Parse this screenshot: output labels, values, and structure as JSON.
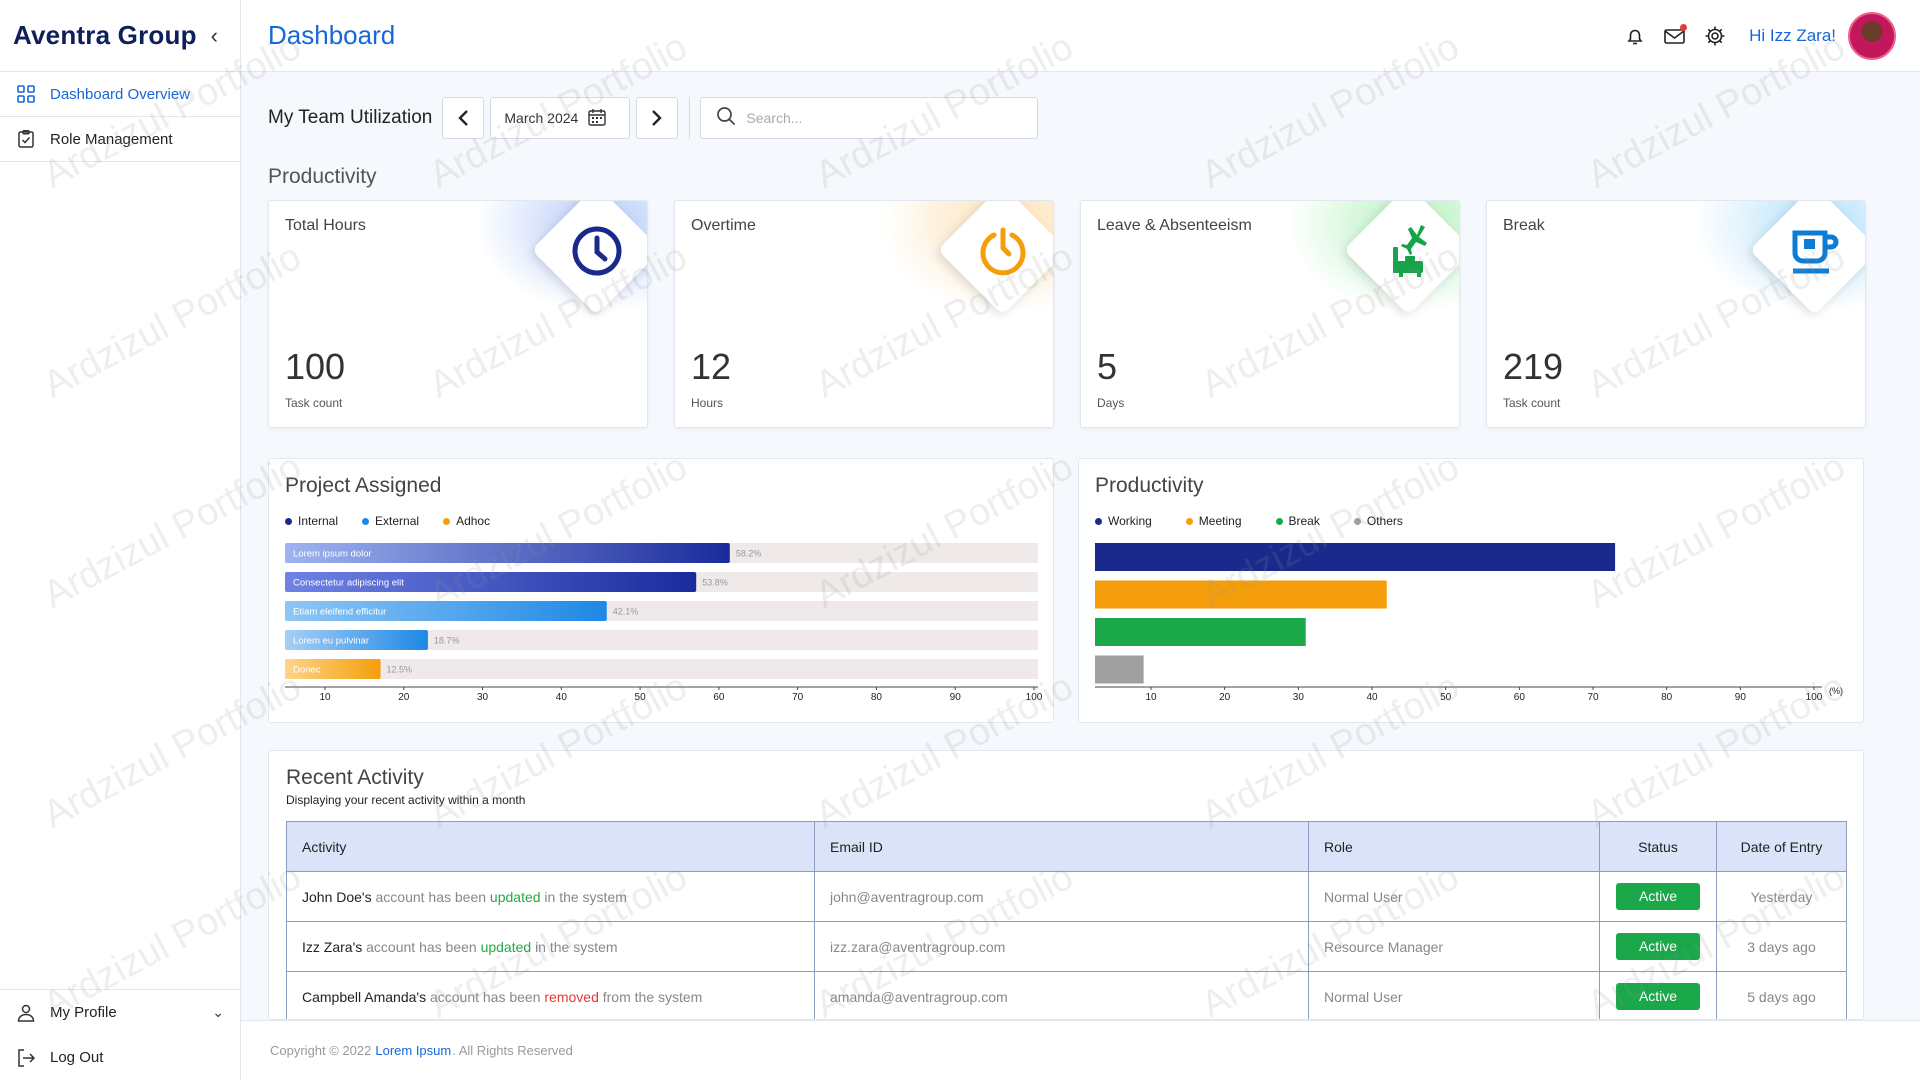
{
  "sidebar": {
    "brand": "Aventra Group",
    "items": [
      {
        "label": "Dashboard Overview"
      },
      {
        "label": "Role Management"
      }
    ],
    "bottom": [
      {
        "label": "My Profile"
      },
      {
        "label": "Log Out"
      }
    ]
  },
  "header": {
    "title": "Dashboard",
    "greeting": "Hi Izz Zara!"
  },
  "toolbar": {
    "title": "My Team Utilization",
    "month": "March 2024",
    "search_placeholder": "Search..."
  },
  "productivity_section": "Productivity",
  "cards": [
    {
      "label": "Total Hours",
      "value": "100",
      "unit": "Task count",
      "icon": "clock-icon",
      "color": "#1a2a8c"
    },
    {
      "label": "Overtime",
      "value": "12",
      "unit": "Hours",
      "icon": "power-timer-icon",
      "color": "#f59e0b"
    },
    {
      "label": "Leave & Absenteeism",
      "value": "5",
      "unit": "Days",
      "icon": "plane-luggage-icon",
      "color": "#16a34a"
    },
    {
      "label": "Break",
      "value": "219",
      "unit": "Task count",
      "icon": "coffee-cup-icon",
      "color": "#0c7cd5"
    }
  ],
  "project_panel": {
    "title": "Project Assigned"
  },
  "productivity_panel": {
    "title": "Productivity"
  },
  "chart_data": [
    {
      "type": "bar",
      "orientation": "horizontal",
      "title": "Project Assigned",
      "legend": [
        "Internal",
        "External",
        "Adhoc"
      ],
      "legend_colors": [
        "#1a2a8c",
        "#1e88e5",
        "#f59e0b"
      ],
      "categories": [
        "Lorem ipsum dolor",
        "Consectetur adipiscing elit",
        "Etiam eleifend efficitur",
        "Lorem eu pulvinar",
        "Donec"
      ],
      "values": [
        58.2,
        53.8,
        42.1,
        18.7,
        12.5
      ],
      "value_labels": [
        "58.2%",
        "53.8%",
        "42.1%",
        "18.7%",
        "12.5%"
      ],
      "xticks": [
        "10",
        "20",
        "30",
        "40",
        "50",
        "60",
        "70",
        "80",
        "90",
        "100"
      ],
      "xlim": [
        3,
        100
      ]
    },
    {
      "type": "bar",
      "orientation": "horizontal",
      "title": "Productivity",
      "legend": [
        "Working",
        "Meeting",
        "Break",
        "Others"
      ],
      "legend_colors": [
        "#1a2a8c",
        "#f59e0b",
        "#1aa84a",
        "#a0a0a0"
      ],
      "values": [
        73,
        42,
        31,
        9
      ],
      "xticks": [
        "10",
        "20",
        "30",
        "40",
        "50",
        "60",
        "70",
        "80",
        "90",
        "100"
      ],
      "xunit": "(%)",
      "xlim": [
        2,
        100
      ]
    }
  ],
  "activity": {
    "title": "Recent Activity",
    "subtitle": "Displaying your recent activity within a month",
    "headers": [
      "Activity",
      "Email ID",
      "Role",
      "Status",
      "Date of Entry"
    ],
    "rows": [
      {
        "name": "John Doe's",
        "pre": "account has been",
        "action": "updated",
        "action_type": "green",
        "post": "in the system",
        "email": "john@aventragroup.com",
        "role": "Normal User",
        "status": "Active",
        "date": "Yesterday"
      },
      {
        "name": "Izz Zara's",
        "pre": "account has been",
        "action": "updated",
        "action_type": "green",
        "post": "in the system",
        "email": "izz.zara@aventragroup.com",
        "role": "Resource Manager",
        "status": "Active",
        "date": "3 days ago"
      },
      {
        "name": "Campbell Amanda's",
        "pre": "account has been",
        "action": "removed",
        "action_type": "red",
        "post": "from the system",
        "email": "amanda@aventragroup.com",
        "role": "Normal User",
        "status": "Active",
        "date": "5 days ago"
      }
    ]
  },
  "footer": {
    "pre": "Copyright © 2022",
    "link": "Lorem Ipsum",
    "post": ". All Rights Reserved"
  },
  "watermark": "Ardzizul Portfolio"
}
